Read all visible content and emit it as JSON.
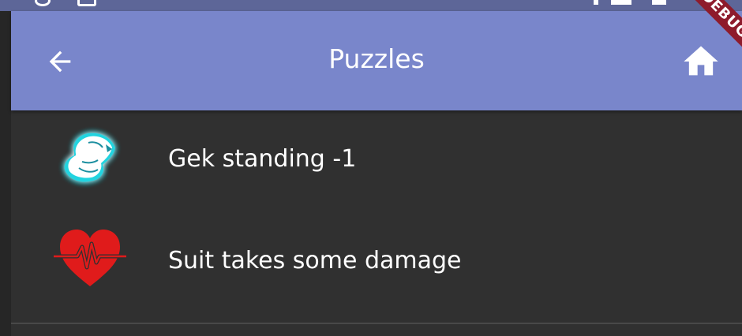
{
  "app_bar": {
    "title": "Puzzles",
    "back_icon": "arrow-back-icon",
    "home_icon": "home-icon",
    "color": "#7986cb"
  },
  "status_bar": {
    "color": "#5d6698"
  },
  "debug_banner": {
    "label": "DEBUG",
    "color": "#8e1b2c"
  },
  "list": {
    "items": [
      {
        "icon": "gek-head-icon",
        "label": "Gek standing -1",
        "icon_color": "#ffffff",
        "glow_color": "#23d4e0"
      },
      {
        "icon": "heartbeat-icon",
        "label": "Suit takes some damage",
        "icon_color": "#e01b1b"
      }
    ]
  },
  "theme": {
    "background": "#303030",
    "text": "#ffffff"
  }
}
